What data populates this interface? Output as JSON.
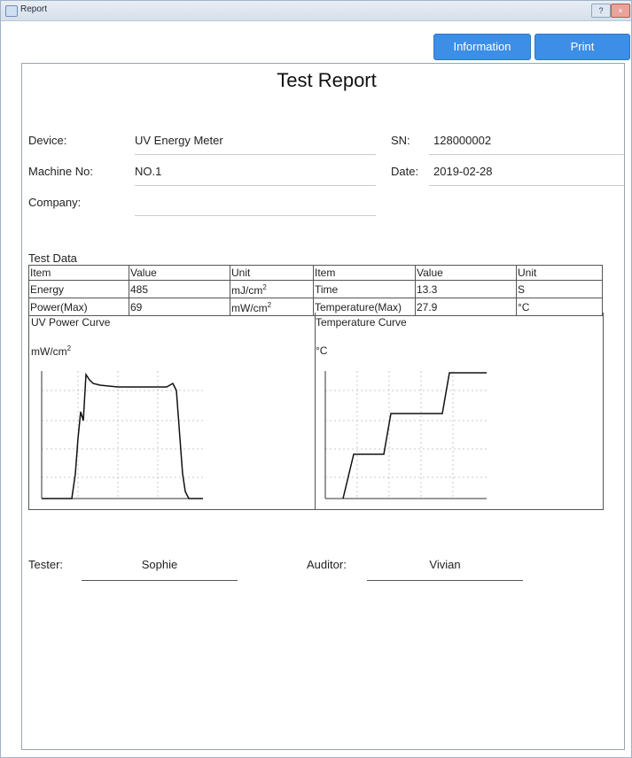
{
  "window": {
    "title": "Report",
    "help_label": "?",
    "close_label": "×"
  },
  "toolbar": {
    "information_label": "Information",
    "print_label": "Print"
  },
  "report": {
    "title": "Test Report",
    "fields": {
      "device_label": "Device:",
      "device_value": "UV Energy Meter",
      "sn_label": "SN:",
      "sn_value": "128000002",
      "machine_label": "Machine No:",
      "machine_value": "NO.1",
      "date_label": "Date:",
      "date_value": "2019-02-28",
      "company_label": "Company:",
      "company_value": ""
    },
    "test_data_label": "Test Data",
    "table": {
      "headers": [
        "Item",
        "Value",
        "Unit",
        "Item",
        "Value",
        "Unit"
      ],
      "rows": [
        [
          "Energy",
          "485",
          "mJ/cm",
          "Time",
          "13.3",
          "S"
        ],
        [
          "Power(Max)",
          "69",
          "mW/cm",
          "Temperature(Max)",
          "27.9",
          "°C"
        ]
      ],
      "unit_superscript": "2"
    },
    "uv_curve": {
      "title": "UV Power Curve",
      "unit": "mW/cm",
      "unit_sup": "2"
    },
    "temp_curve": {
      "title": "Temperature Curve",
      "unit": "°C"
    },
    "signatures": {
      "tester_label": "Tester:",
      "tester_value": "Sophie",
      "auditor_label": "Auditor:",
      "auditor_value": "Vivian"
    }
  }
}
